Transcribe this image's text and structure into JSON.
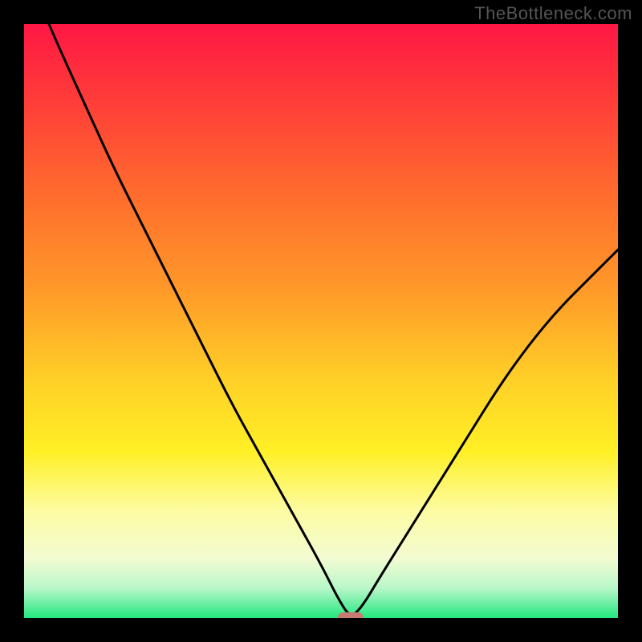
{
  "watermark": "TheBottleneck.com",
  "colors": {
    "bg": "#000000",
    "curve": "#000000",
    "marker": "#c77a72",
    "gradient_stops": [
      {
        "offset": "0%",
        "color": "#ff1744"
      },
      {
        "offset": "12%",
        "color": "#ff3a3a"
      },
      {
        "offset": "28%",
        "color": "#ff6a2e"
      },
      {
        "offset": "45%",
        "color": "#ff9a29"
      },
      {
        "offset": "60%",
        "color": "#ffd027"
      },
      {
        "offset": "72%",
        "color": "#fff026"
      },
      {
        "offset": "82%",
        "color": "#fdfca3"
      },
      {
        "offset": "90%",
        "color": "#f3fbd2"
      },
      {
        "offset": "95%",
        "color": "#b8f7c9"
      },
      {
        "offset": "100%",
        "color": "#23e87f"
      }
    ]
  },
  "chart_data": {
    "type": "line",
    "title": "",
    "xlabel": "",
    "ylabel": "",
    "xlim": [
      0,
      100
    ],
    "ylim": [
      0,
      100
    ],
    "x": [
      0,
      5,
      10,
      15,
      20,
      25,
      30,
      35,
      40,
      45,
      50,
      53,
      55,
      57,
      60,
      65,
      70,
      75,
      80,
      85,
      90,
      95,
      100
    ],
    "values": [
      110,
      98,
      87,
      76,
      66,
      56,
      46,
      36,
      27,
      18,
      9,
      3,
      0,
      2,
      7,
      15,
      23,
      31,
      39,
      46,
      52,
      57,
      62
    ],
    "marker": {
      "x": 55,
      "y": 0
    }
  }
}
